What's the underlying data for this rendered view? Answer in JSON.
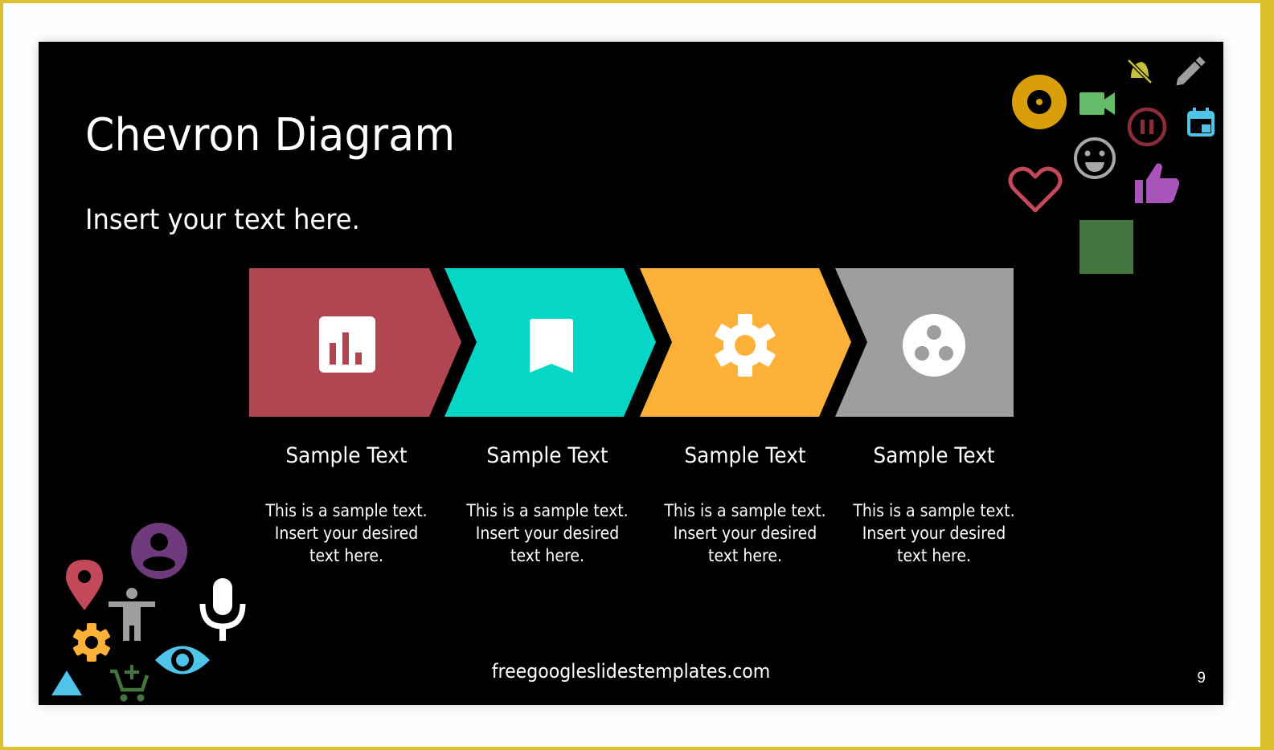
{
  "slide": {
    "title": "Chevron Diagram",
    "subtitle": "Insert your text here.",
    "footer_url": "freegoogleslidestemplates.com",
    "page_number": "9",
    "background": "#000000"
  },
  "frame": {
    "border_color": "#dcc12e",
    "page_color": "#fefefe"
  },
  "steps": [
    {
      "color": "#b04652",
      "icon": "bar-chart-icon",
      "heading": "Sample Text",
      "body_lines": [
        "This is a sample text.",
        "Insert your desired",
        "text here."
      ]
    },
    {
      "color": "#06d6c6",
      "icon": "bookmark-icon",
      "heading": "Sample Text",
      "body_lines": [
        "This is a sample text.",
        "Insert your desired",
        "text here."
      ]
    },
    {
      "color": "#fdb138",
      "icon": "gear-icon",
      "heading": "Sample Text",
      "body_lines": [
        "This is a sample text.",
        "Insert your desired",
        "text here."
      ]
    },
    {
      "color": "#9e9e9e",
      "icon": "workspaces-icon",
      "heading": "Sample Text",
      "body_lines": [
        "This is a sample text.",
        "Insert your desired",
        "text here."
      ]
    }
  ],
  "decorative_icons": {
    "top_right": [
      {
        "name": "disc-icon",
        "color": "#d89f0a"
      },
      {
        "name": "videocam-icon",
        "color": "#66bb6a"
      },
      {
        "name": "notifications-off-icon",
        "color": "#c6bf3e"
      },
      {
        "name": "pencil-icon",
        "color": "#9e9e9e"
      },
      {
        "name": "pause-circle-icon",
        "color": "#8b2c3a"
      },
      {
        "name": "calendar-icon",
        "color": "#4fc3e8"
      },
      {
        "name": "smiley-icon",
        "color": "#a8a8a8"
      },
      {
        "name": "heart-outline-icon",
        "color": "#c2485a"
      },
      {
        "name": "thumbs-up-icon",
        "color": "#a755b9"
      },
      {
        "name": "square-icon",
        "color": "#43753f"
      }
    ],
    "bottom_left": [
      {
        "name": "account-circle-icon",
        "color": "#6e3a7c"
      },
      {
        "name": "location-pin-icon",
        "color": "#c2485a"
      },
      {
        "name": "accessibility-icon",
        "color": "#9e9e9e"
      },
      {
        "name": "microphone-icon",
        "color": "#ffffff"
      },
      {
        "name": "settings-icon",
        "color": "#fdb138"
      },
      {
        "name": "eye-icon",
        "color": "#4fc3e8"
      },
      {
        "name": "triangle-icon",
        "color": "#4fc3e8"
      },
      {
        "name": "add-to-cart-icon",
        "color": "#43753f"
      }
    ]
  }
}
